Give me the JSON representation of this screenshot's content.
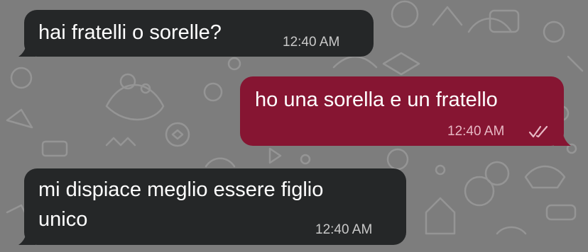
{
  "chat": {
    "messages": [
      {
        "direction": "incoming",
        "text": "hai fratelli o sorelle?",
        "time": "12:40 AM"
      },
      {
        "direction": "outgoing",
        "text": "ho una sorella e un fratello",
        "time": "12:40 AM",
        "status": "read"
      },
      {
        "direction": "incoming",
        "text_line1": "mi dispiace meglio essere figlio",
        "text_line2": "unico",
        "time": "12:40 AM"
      }
    ]
  },
  "theme": {
    "background": "#7d7d7d",
    "incoming_bubble": "#252728",
    "outgoing_bubble": "#861532"
  }
}
